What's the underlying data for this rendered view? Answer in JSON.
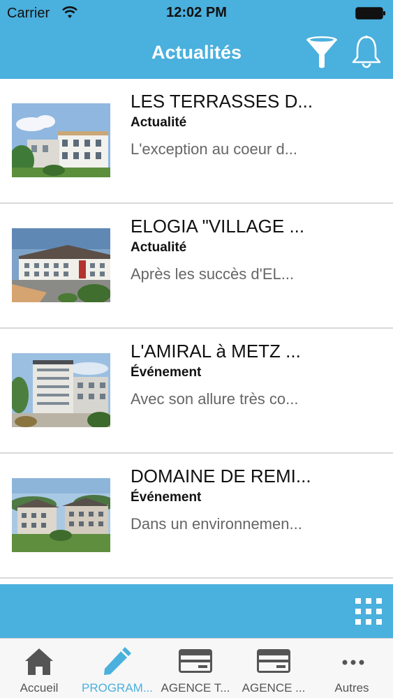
{
  "status_bar": {
    "carrier": "Carrier",
    "time": "12:02 PM"
  },
  "header": {
    "title": "Actualités",
    "accent": "#4ab0dd"
  },
  "items": [
    {
      "name": "LES TERRASSES D...",
      "kind": "Actualité",
      "desc": "L'exception au coeur d..."
    },
    {
      "name": "ELOGIA \"VILLAGE ...",
      "kind": "Actualité",
      "desc": "Après les succès d'EL..."
    },
    {
      "name": "L'AMIRAL à METZ ...",
      "kind": "Événement",
      "desc": "Avec son allure très co..."
    },
    {
      "name": "DOMAINE DE REMI...",
      "kind": "Événement",
      "desc": "Dans un environnemen..."
    }
  ],
  "tabs": [
    {
      "label": "Accueil",
      "icon": "home-icon"
    },
    {
      "label": "PROGRAM...",
      "icon": "pencil-icon",
      "active": true
    },
    {
      "label": "AGENCE T...",
      "icon": "card-icon"
    },
    {
      "label": "AGENCE ...",
      "icon": "card-icon"
    },
    {
      "label": "Autres",
      "icon": "more-icon"
    }
  ]
}
